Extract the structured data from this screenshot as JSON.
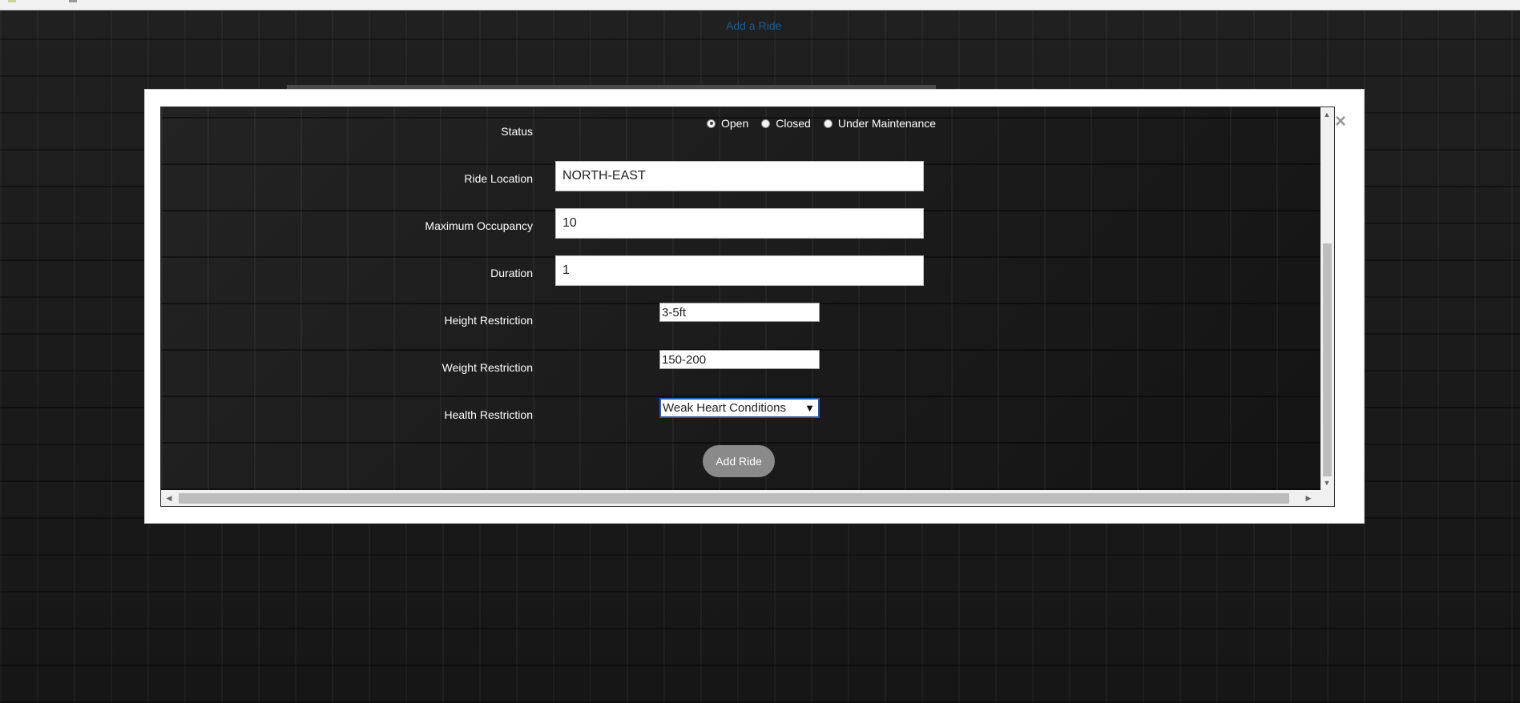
{
  "top_link": {
    "label": "Add a Ride"
  },
  "modal": {
    "close_label": "×"
  },
  "form": {
    "status": {
      "label": "Status",
      "options": [
        {
          "label": "Open",
          "checked": true
        },
        {
          "label": "Closed",
          "checked": false
        },
        {
          "label": "Under Maintenance",
          "checked": false
        }
      ]
    },
    "ride_location": {
      "label": "Ride Location",
      "value": "NORTH-EAST"
    },
    "maximum_occupancy": {
      "label": "Maximum Occupancy",
      "value": "10"
    },
    "duration": {
      "label": "Duration",
      "value": "1"
    },
    "height_restriction": {
      "label": "Height Restriction",
      "value": "3-5ft"
    },
    "weight_restriction": {
      "label": "Weight Restriction",
      "value": "150-200"
    },
    "health_restriction": {
      "label": "Health Restriction",
      "selected": "Weak Heart Conditions",
      "arrow": "▼"
    },
    "submit_label": "Add Ride"
  },
  "scrollbars": {
    "up": "▲",
    "down": "▼",
    "left": "◀",
    "right": "▶"
  },
  "colors": {
    "link": "#1d5e93",
    "button": "#8a8a8a",
    "select_border": "#2a5caa"
  }
}
